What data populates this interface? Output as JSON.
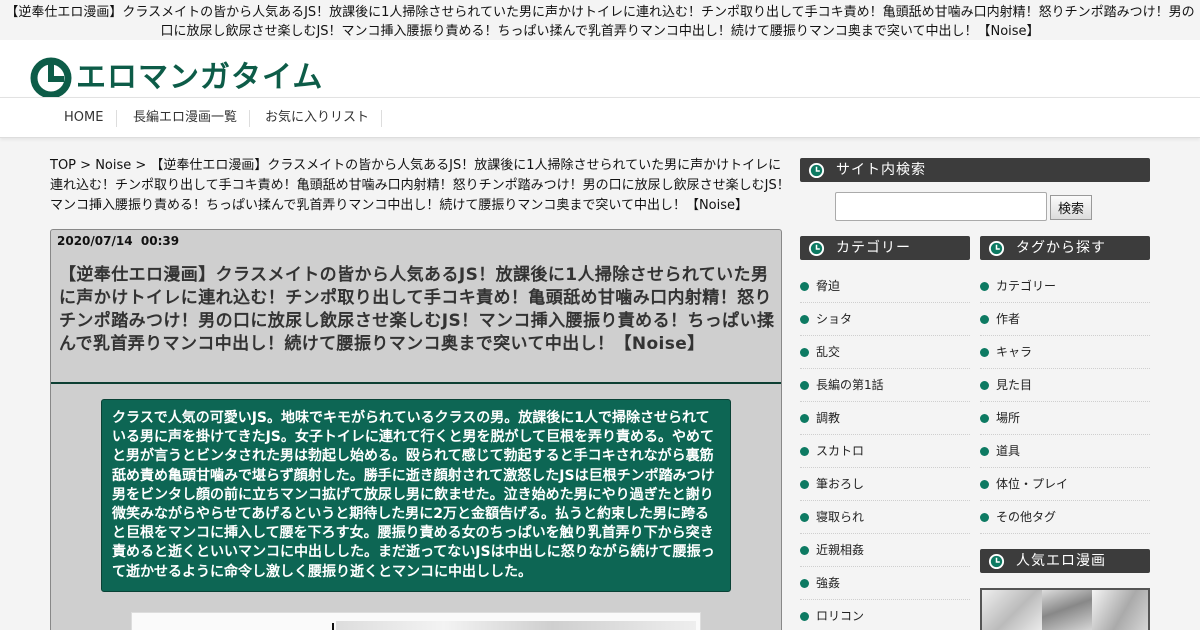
{
  "page_title": "【逆奉仕エロ漫画】クラスメイトの皆から人気あるJS！放課後に1人掃除させられていた男に声かけトイレに連れ込む！チンポ取り出して手コキ責め！亀頭舐め甘噛み口内射精！怒りチンポ踏みつけ！男の口に放尿し飲尿させ楽しむJS！マンコ挿入腰振り責める！ちっぱい揉んで乳首弄りマンコ中出し！続けて腰振りマンコ奥まで突いて中出し！【Noise】",
  "site": {
    "logo_text": "エロマンガタイム",
    "brand_color": "#0d5c48"
  },
  "nav": {
    "items": [
      "HOME",
      "長編エロ漫画一覧",
      "お気に入りリスト"
    ]
  },
  "breadcrumb": {
    "top": "TOP",
    "sep": " > ",
    "category": "Noise",
    "current": "【逆奉仕エロ漫画】クラスメイトの皆から人気あるJS！放課後に1人掃除させられていた男に声かけトイレに連れ込む！チンポ取り出して手コキ責め！亀頭舐め甘噛み口内射精！怒りチンポ踏みつけ！男の口に放尿し飲尿させ楽しむJS！マンコ挿入腰振り責める！ちっぱい揉んで乳首弄りマンコ中出し！続けて腰振りマンコ奥まで突いて中出し！【Noise】"
  },
  "article": {
    "date": "2020/07/14",
    "time": "00:39",
    "title": "【逆奉仕エロ漫画】クラスメイトの皆から人気あるJS！放課後に1人掃除させられていた男に声かけトイレに連れ込む！チンポ取り出して手コキ責め！亀頭舐め甘噛み口内射精！怒りチンポ踏みつけ！男の口に放尿し飲尿させ楽しむJS！マンコ挿入腰振り責める！ちっぱい揉んで乳首弄りマンコ中出し！続けて腰振りマンコ奥まで突いて中出し！【Noise】",
    "summary": "クラスで人気の可愛いJS。地味でキモがられているクラスの男。放課後に1人で掃除させられている男に声を掛けてきたJS。女子トイレに連れて行くと男を脱がして巨根を弄り責める。やめてと男が言うとビンタされた男は勃起し始める。殴られて感じて勃起すると手コキされながら裏筋舐め責め亀頭甘噛みで堪らず顔射した。勝手に逝き顔射されて激怒したJSは巨根チンポ踏みつけ男をビンタし顔の前に立ちマンコ拡げて放尿し男に飲ませた。泣き始めた男にやり過ぎたと謝り微笑みながらやらせてあげるというと期待した男に2万と金額告げる。払うと約束した男に跨ると巨根をマンコに挿入して腰を下ろす女。腰振り責める女のちっぱいを触り乳首弄り下から突き責めると逝くといいマンコに中出しした。まだ逝ってないJSは中出しに怒りながら続けて腰振って逝かせるように命令し激しく腰振り逝くとマンコに中出しした。"
  },
  "sidebar": {
    "search": {
      "heading": "サイト内検索",
      "placeholder": "",
      "button_label": "検索"
    },
    "categories": {
      "heading": "カテゴリー",
      "items": [
        "脅迫",
        "ショタ",
        "乱交",
        "長編の第1話",
        "調教",
        "スカトロ",
        "筆おろし",
        "寝取られ",
        "近親相姦",
        "強姦",
        "ロリコン"
      ]
    },
    "tags": {
      "heading": "タグから探す",
      "items": [
        "カテゴリー",
        "作者",
        "キャラ",
        "見た目",
        "場所",
        "道具",
        "体位・プレイ",
        "その他タグ"
      ]
    },
    "popular": {
      "heading": "人気エロ漫画"
    }
  },
  "icons": {
    "logo": "clock-icon",
    "section": "clock-icon",
    "bullet": "dot-icon"
  }
}
